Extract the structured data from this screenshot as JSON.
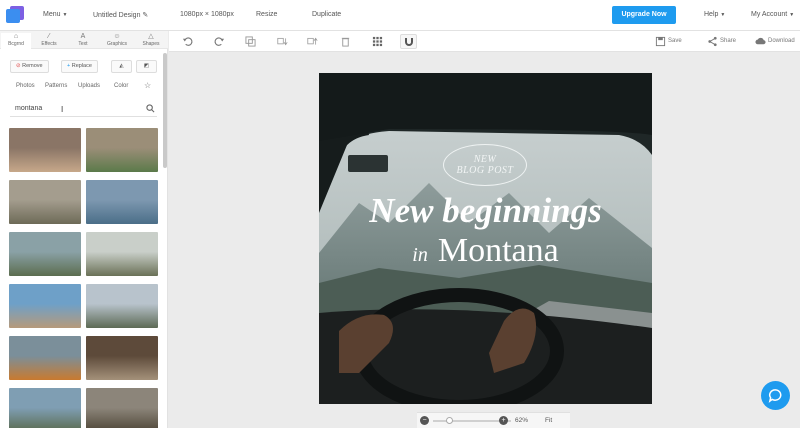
{
  "topbar": {
    "menu": "Menu",
    "design_name": "Untitled Design",
    "dimensions": "1080px × 1080px",
    "resize": "Resize",
    "duplicate": "Duplicate",
    "upgrade": "Upgrade Now",
    "help": "Help",
    "account": "My Account"
  },
  "panel": {
    "tabs": [
      "Bcgrnd",
      "Effects",
      "Text",
      "Graphics",
      "Shapes"
    ],
    "tab_icons": [
      "house-icon",
      "wand-icon",
      "letter-a-icon",
      "smiley-icon",
      "triangle-icon"
    ],
    "buttons": {
      "remove": "Remove",
      "replace": "Replace"
    },
    "subtabs": [
      "Photos",
      "Patterns",
      "Uploads",
      "Color"
    ],
    "search": {
      "value": "montana"
    },
    "thumb_colors": [
      [
        "#8a7566",
        "#c7a88a"
      ],
      [
        "#9b8e78",
        "#5b7a4a"
      ],
      [
        "#a49d8e",
        "#6d6a57"
      ],
      [
        "#7d98b0",
        "#4b6e88"
      ],
      [
        "#8aa1a6",
        "#5b6d4f"
      ],
      [
        "#c9cfc9",
        "#6a7157"
      ],
      [
        "#6ea0c8",
        "#b79a7a"
      ],
      [
        "#b8c3cc",
        "#5d6a55"
      ],
      [
        "#7b8f9a",
        "#c97a2f"
      ],
      [
        "#5d4a3a",
        "#a4917a"
      ],
      [
        "#7f9eb3",
        "#5a6a4e"
      ],
      [
        "#8c857a",
        "#4d4536"
      ]
    ]
  },
  "toolbar": {
    "save": "Save",
    "share": "Share",
    "download": "Download"
  },
  "canvas": {
    "badge_line1": "NEW",
    "badge_line2": "BLOG POST",
    "headline": "New beginnings",
    "in_word": "in",
    "place": "Montana"
  },
  "zoom": {
    "value": "62%",
    "fit": "Fit",
    "level_fraction": 0.2
  },
  "colors": {
    "accent": "#1e9bef",
    "logo_blue": "#3b8ef0",
    "logo_purple": "#6f4fe0"
  }
}
